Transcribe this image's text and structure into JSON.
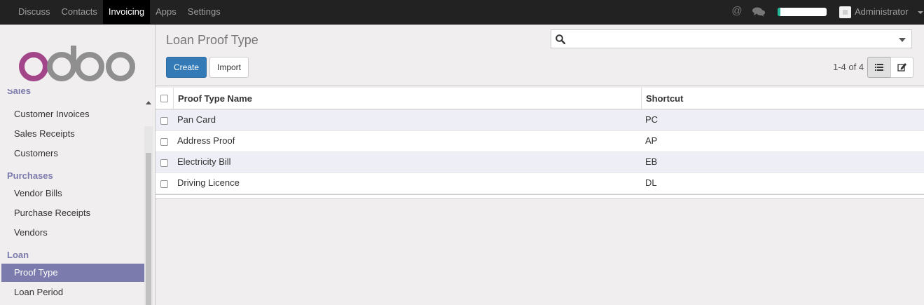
{
  "topbar": {
    "menu": [
      "Discuss",
      "Contacts",
      "Invoicing",
      "Apps",
      "Settings"
    ],
    "active_menu": "Invoicing",
    "progress": 0.06,
    "progress_color": "#21b799",
    "user_name": "Administrator",
    "icons": [
      "at-icon",
      "chat-icon",
      "user-avatar",
      "chevron-down-icon"
    ]
  },
  "sidebar": {
    "logo_text": "odoo",
    "sections": [
      {
        "title": "Sales",
        "items": [
          "Customer Invoices",
          "Sales Receipts",
          "Customers"
        ]
      },
      {
        "title": "Purchases",
        "items": [
          "Vendor Bills",
          "Purchase Receipts",
          "Vendors"
        ]
      },
      {
        "title": "Loan",
        "items": [
          "Proof Type",
          "Loan Period"
        ]
      }
    ],
    "active_item": "Proof Type",
    "accent_color": "#7c7bad"
  },
  "control_panel": {
    "title": "Loan Proof Type",
    "search_value": "",
    "create_label": "Create",
    "import_label": "Import",
    "pager": "1-4 of 4",
    "primary_color": "#337ab7"
  },
  "table": {
    "headers": [
      "Proof Type Name",
      "Shortcut"
    ],
    "rows": [
      {
        "name": "Pan Card",
        "shortcut": "PC"
      },
      {
        "name": "Address Proof",
        "shortcut": "AP"
      },
      {
        "name": "Electricity Bill",
        "shortcut": "EB"
      },
      {
        "name": "Driving Licence",
        "shortcut": "DL"
      }
    ]
  }
}
